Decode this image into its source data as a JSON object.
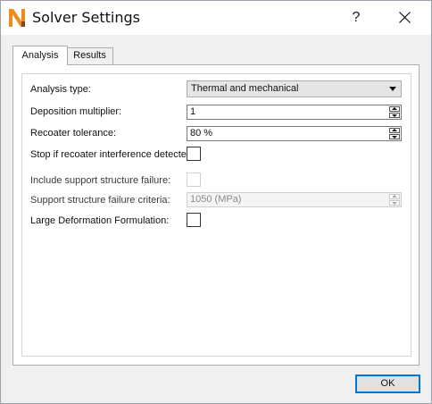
{
  "window": {
    "title": "Solver Settings",
    "help_label": "?"
  },
  "tabs": [
    {
      "label": "Analysis",
      "active": true
    },
    {
      "label": "Results",
      "active": false
    }
  ],
  "form": {
    "analysis_type": {
      "label": "Analysis type:",
      "value": "Thermal and mechanical"
    },
    "deposition_multiplier": {
      "label": "Deposition multiplier:",
      "value": "1"
    },
    "recoater_tolerance": {
      "label": "Recoater tolerance:",
      "value": "80 %"
    },
    "stop_recoater_interference": {
      "label": "Stop if recoater interference detected:",
      "checked": false
    },
    "include_support_failure": {
      "label": "Include support structure failure:",
      "checked": false,
      "enabled": false
    },
    "support_failure_criteria": {
      "label": "Support structure failure criteria:",
      "value": "1050 (MPa)",
      "enabled": false
    },
    "large_deformation": {
      "label": "Large Deformation Formulation:",
      "checked": false
    }
  },
  "footer": {
    "ok_label": "OK"
  },
  "colors": {
    "accent": "#0078d7",
    "app_icon_orange": "#f08a1c"
  },
  "icons": [
    "app-logo-icon",
    "help-icon",
    "close-icon",
    "dropdown-arrow-icon",
    "spin-up-icon",
    "spin-down-icon"
  ]
}
